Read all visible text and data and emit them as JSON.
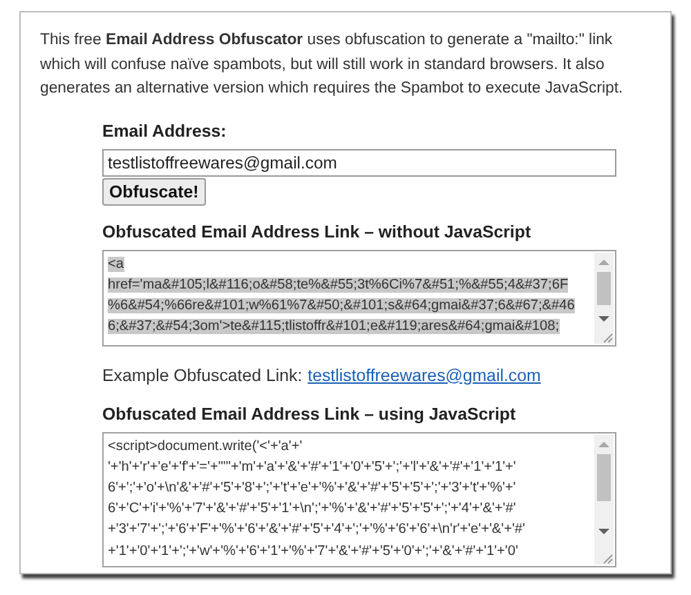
{
  "intro": "This free **Email Address Obfuscator** uses obfuscation to generate a \"mailto:\" link which will confuse naïve spambots, but will still work in standard browsers. It also generates an alternative version which requires the Spambot to execute JavaScript.",
  "email_field": {
    "label": "Email Address:",
    "value": "testlistoffreewares@gmail.com"
  },
  "button": "Obfuscate!",
  "outputs": [
    {
      "kind": "code",
      "heading": "Obfuscated Email Address Link – without JavaScript",
      "selected": true,
      "lines": [
        "<a",
        "href='ma&#105;l&#116;o&#58;te%&#55;3t%6Ci%7&#51;%&#55;4&#37;6F",
        "%6&#54;%66re&#101;w%61%7&#50;&#101;s&#64;gmai&#37;6&#67;&#46",
        "6;&#37;&#54;3om'>te&#115;tlistoffr&#101;e&#119;ares&#64;gmai&#108;"
      ]
    },
    {
      "kind": "example",
      "label": "Example Obfuscated Link:",
      "link": "testlistoffreewares@gmail.com"
    },
    {
      "kind": "code",
      "heading": "Obfuscated Email Address Link – using JavaScript",
      "selected": false,
      "lines": [
        "<script>document.write('<'+'a'+'",
        "'+'h'+'r'+'e'+'f'+'='+\"'\"+'m'+'a'+'&'+'#'+'1'+'0'+'5'+';'+'l'+'&'+'#'+'1'+'1'+'",
        "6'+';'+'o'+\\n'&'+'#'+'5'+'8'+';'+'t'+'e'+'%'+'&'+'#'+'5'+'5'+';'+'3'+'t'+'%'+'",
        "6'+'C'+'i'+'%'+'7'+'&'+'#'+'5'+'1'+\\n';'+'%'+'&'+'#'+'5'+'5'+';'+'4'+'&'+'#'",
        "+'3'+'7'+';'+'6'+'F'+'%'+'6'+'&'+'#'+'5'+'4'+';'+'%'+'6'+'6'+\\n'r'+'e'+'&'+'#'",
        "+'1'+'0'+'1'+';'+'w'+'%'+'6'+'1'+'%'+'7'+'&'+'#'+'5'+'0'+';'+'&'+'#'+'1'+'0'"
      ]
    }
  ]
}
